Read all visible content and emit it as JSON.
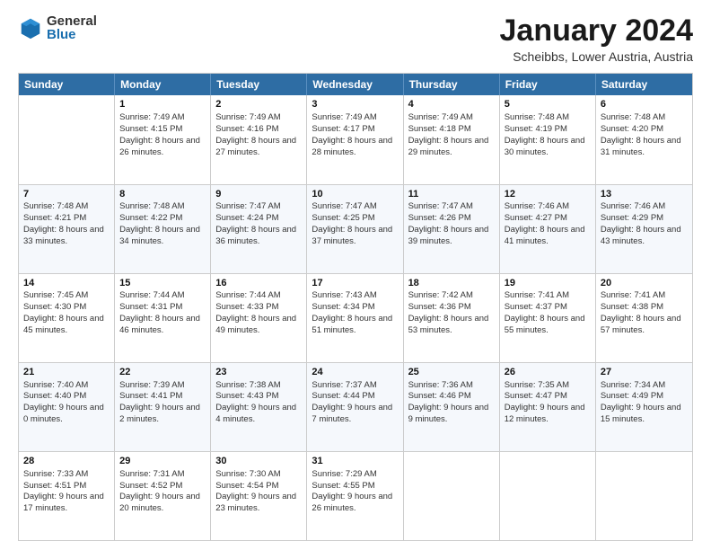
{
  "logo": {
    "general": "General",
    "blue": "Blue"
  },
  "title": "January 2024",
  "subtitle": "Scheibbs, Lower Austria, Austria",
  "header_days": [
    "Sunday",
    "Monday",
    "Tuesday",
    "Wednesday",
    "Thursday",
    "Friday",
    "Saturday"
  ],
  "weeks": [
    [
      {
        "day": "",
        "sunrise": "",
        "sunset": "",
        "daylight": ""
      },
      {
        "day": "1",
        "sunrise": "Sunrise: 7:49 AM",
        "sunset": "Sunset: 4:15 PM",
        "daylight": "Daylight: 8 hours and 26 minutes."
      },
      {
        "day": "2",
        "sunrise": "Sunrise: 7:49 AM",
        "sunset": "Sunset: 4:16 PM",
        "daylight": "Daylight: 8 hours and 27 minutes."
      },
      {
        "day": "3",
        "sunrise": "Sunrise: 7:49 AM",
        "sunset": "Sunset: 4:17 PM",
        "daylight": "Daylight: 8 hours and 28 minutes."
      },
      {
        "day": "4",
        "sunrise": "Sunrise: 7:49 AM",
        "sunset": "Sunset: 4:18 PM",
        "daylight": "Daylight: 8 hours and 29 minutes."
      },
      {
        "day": "5",
        "sunrise": "Sunrise: 7:48 AM",
        "sunset": "Sunset: 4:19 PM",
        "daylight": "Daylight: 8 hours and 30 minutes."
      },
      {
        "day": "6",
        "sunrise": "Sunrise: 7:48 AM",
        "sunset": "Sunset: 4:20 PM",
        "daylight": "Daylight: 8 hours and 31 minutes."
      }
    ],
    [
      {
        "day": "7",
        "sunrise": "Sunrise: 7:48 AM",
        "sunset": "Sunset: 4:21 PM",
        "daylight": "Daylight: 8 hours and 33 minutes."
      },
      {
        "day": "8",
        "sunrise": "Sunrise: 7:48 AM",
        "sunset": "Sunset: 4:22 PM",
        "daylight": "Daylight: 8 hours and 34 minutes."
      },
      {
        "day": "9",
        "sunrise": "Sunrise: 7:47 AM",
        "sunset": "Sunset: 4:24 PM",
        "daylight": "Daylight: 8 hours and 36 minutes."
      },
      {
        "day": "10",
        "sunrise": "Sunrise: 7:47 AM",
        "sunset": "Sunset: 4:25 PM",
        "daylight": "Daylight: 8 hours and 37 minutes."
      },
      {
        "day": "11",
        "sunrise": "Sunrise: 7:47 AM",
        "sunset": "Sunset: 4:26 PM",
        "daylight": "Daylight: 8 hours and 39 minutes."
      },
      {
        "day": "12",
        "sunrise": "Sunrise: 7:46 AM",
        "sunset": "Sunset: 4:27 PM",
        "daylight": "Daylight: 8 hours and 41 minutes."
      },
      {
        "day": "13",
        "sunrise": "Sunrise: 7:46 AM",
        "sunset": "Sunset: 4:29 PM",
        "daylight": "Daylight: 8 hours and 43 minutes."
      }
    ],
    [
      {
        "day": "14",
        "sunrise": "Sunrise: 7:45 AM",
        "sunset": "Sunset: 4:30 PM",
        "daylight": "Daylight: 8 hours and 45 minutes."
      },
      {
        "day": "15",
        "sunrise": "Sunrise: 7:44 AM",
        "sunset": "Sunset: 4:31 PM",
        "daylight": "Daylight: 8 hours and 46 minutes."
      },
      {
        "day": "16",
        "sunrise": "Sunrise: 7:44 AM",
        "sunset": "Sunset: 4:33 PM",
        "daylight": "Daylight: 8 hours and 49 minutes."
      },
      {
        "day": "17",
        "sunrise": "Sunrise: 7:43 AM",
        "sunset": "Sunset: 4:34 PM",
        "daylight": "Daylight: 8 hours and 51 minutes."
      },
      {
        "day": "18",
        "sunrise": "Sunrise: 7:42 AM",
        "sunset": "Sunset: 4:36 PM",
        "daylight": "Daylight: 8 hours and 53 minutes."
      },
      {
        "day": "19",
        "sunrise": "Sunrise: 7:41 AM",
        "sunset": "Sunset: 4:37 PM",
        "daylight": "Daylight: 8 hours and 55 minutes."
      },
      {
        "day": "20",
        "sunrise": "Sunrise: 7:41 AM",
        "sunset": "Sunset: 4:38 PM",
        "daylight": "Daylight: 8 hours and 57 minutes."
      }
    ],
    [
      {
        "day": "21",
        "sunrise": "Sunrise: 7:40 AM",
        "sunset": "Sunset: 4:40 PM",
        "daylight": "Daylight: 9 hours and 0 minutes."
      },
      {
        "day": "22",
        "sunrise": "Sunrise: 7:39 AM",
        "sunset": "Sunset: 4:41 PM",
        "daylight": "Daylight: 9 hours and 2 minutes."
      },
      {
        "day": "23",
        "sunrise": "Sunrise: 7:38 AM",
        "sunset": "Sunset: 4:43 PM",
        "daylight": "Daylight: 9 hours and 4 minutes."
      },
      {
        "day": "24",
        "sunrise": "Sunrise: 7:37 AM",
        "sunset": "Sunset: 4:44 PM",
        "daylight": "Daylight: 9 hours and 7 minutes."
      },
      {
        "day": "25",
        "sunrise": "Sunrise: 7:36 AM",
        "sunset": "Sunset: 4:46 PM",
        "daylight": "Daylight: 9 hours and 9 minutes."
      },
      {
        "day": "26",
        "sunrise": "Sunrise: 7:35 AM",
        "sunset": "Sunset: 4:47 PM",
        "daylight": "Daylight: 9 hours and 12 minutes."
      },
      {
        "day": "27",
        "sunrise": "Sunrise: 7:34 AM",
        "sunset": "Sunset: 4:49 PM",
        "daylight": "Daylight: 9 hours and 15 minutes."
      }
    ],
    [
      {
        "day": "28",
        "sunrise": "Sunrise: 7:33 AM",
        "sunset": "Sunset: 4:51 PM",
        "daylight": "Daylight: 9 hours and 17 minutes."
      },
      {
        "day": "29",
        "sunrise": "Sunrise: 7:31 AM",
        "sunset": "Sunset: 4:52 PM",
        "daylight": "Daylight: 9 hours and 20 minutes."
      },
      {
        "day": "30",
        "sunrise": "Sunrise: 7:30 AM",
        "sunset": "Sunset: 4:54 PM",
        "daylight": "Daylight: 9 hours and 23 minutes."
      },
      {
        "day": "31",
        "sunrise": "Sunrise: 7:29 AM",
        "sunset": "Sunset: 4:55 PM",
        "daylight": "Daylight: 9 hours and 26 minutes."
      },
      {
        "day": "",
        "sunrise": "",
        "sunset": "",
        "daylight": ""
      },
      {
        "day": "",
        "sunrise": "",
        "sunset": "",
        "daylight": ""
      },
      {
        "day": "",
        "sunrise": "",
        "sunset": "",
        "daylight": ""
      }
    ]
  ]
}
